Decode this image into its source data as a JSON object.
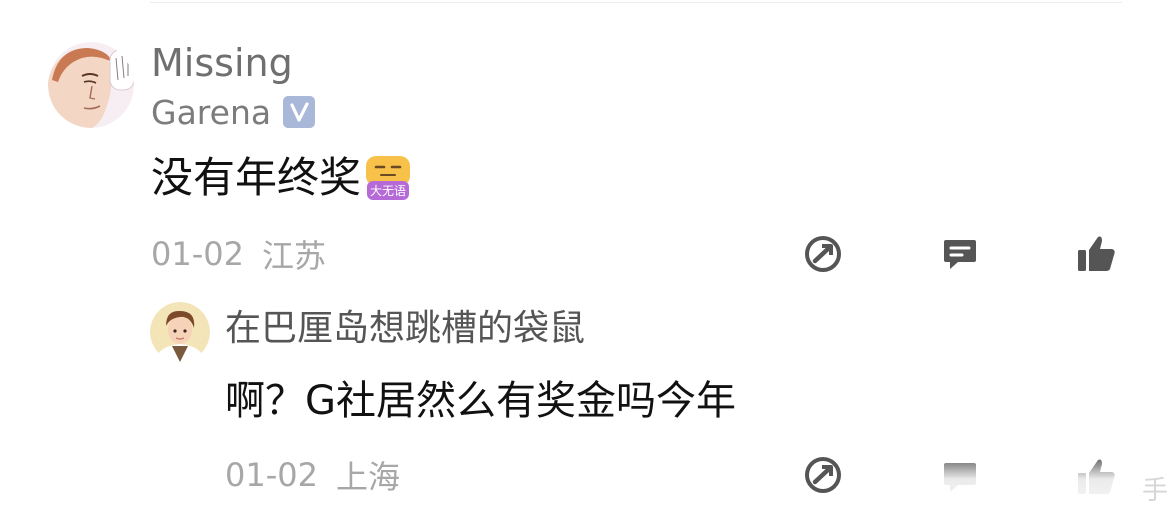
{
  "main_comment": {
    "username": "Missing",
    "org": "Garena",
    "verified_icon": "verified-v-icon",
    "text": "没有年终奖",
    "emoji": "大无语",
    "date": "01-02",
    "location": "江苏",
    "actions": [
      "share-icon",
      "reply-icon",
      "like-icon"
    ]
  },
  "reply": {
    "username": "在巴厘岛想跳槽的袋鼠",
    "text": "啊？G社居然么有奖金吗今年",
    "date": "01-02",
    "location": "上海",
    "actions": [
      "share-icon",
      "reply-icon",
      "like-icon"
    ]
  },
  "watermark": "手",
  "colors": {
    "name_gray": "#6f6f6f",
    "meta_gray": "#a7a7a7",
    "icon_gray": "#555555",
    "verified_bg": "#a9b8d9",
    "emoji_orange": "#f7c14a",
    "emoji_purple": "#b66ad8"
  }
}
